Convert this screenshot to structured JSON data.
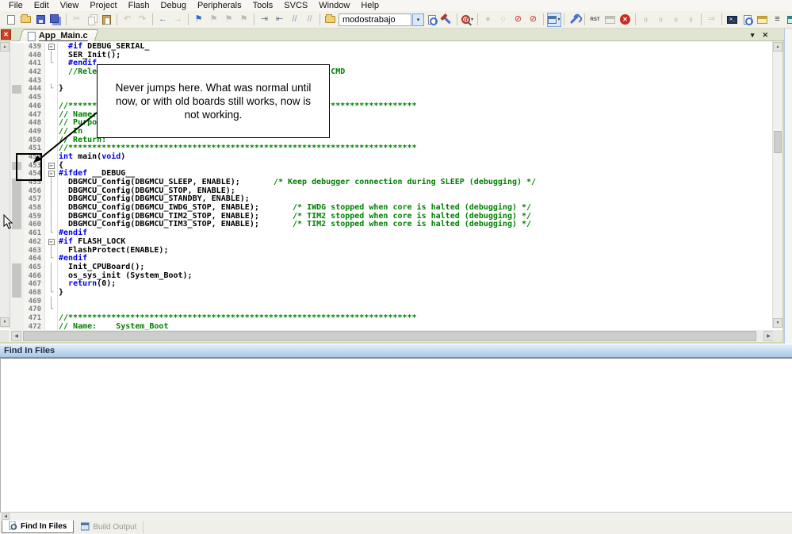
{
  "menu": {
    "items": [
      "File",
      "Edit",
      "View",
      "Project",
      "Flash",
      "Debug",
      "Peripherals",
      "Tools",
      "SVCS",
      "Window",
      "Help"
    ]
  },
  "toolbar": {
    "target_value": "modostrabajo",
    "items": [
      {
        "k": "icon",
        "n": "new-file-icon",
        "sh": "page"
      },
      {
        "k": "icon",
        "n": "open-file-icon",
        "sh": "folder"
      },
      {
        "k": "icon",
        "n": "save-icon",
        "sh": "floppy"
      },
      {
        "k": "icon",
        "n": "save-all-icon",
        "sh": "floppy2"
      },
      {
        "k": "sep"
      },
      {
        "k": "icon",
        "n": "cut-icon",
        "g": "✂",
        "col": "#9a9a93",
        "dis": true
      },
      {
        "k": "icon",
        "n": "copy-icon",
        "sh": "copy",
        "dis": true
      },
      {
        "k": "icon",
        "n": "paste-icon",
        "sh": "paste"
      },
      {
        "k": "sep"
      },
      {
        "k": "icon",
        "n": "undo-icon",
        "g": "↶",
        "col": "#9a9a93",
        "dis": true
      },
      {
        "k": "icon",
        "n": "redo-icon",
        "g": "↷",
        "col": "#9a9a93",
        "dis": true
      },
      {
        "k": "sep"
      },
      {
        "k": "icon",
        "n": "navigate-back-icon",
        "g": "←",
        "col": "#5b7aa8"
      },
      {
        "k": "icon",
        "n": "navigate-forward-icon",
        "g": "→",
        "col": "#8a98a8",
        "dis": true
      },
      {
        "k": "sep"
      },
      {
        "k": "icon",
        "n": "toggle-bookmark-icon",
        "g": "⚑",
        "col": "#2a6fd0"
      },
      {
        "k": "icon",
        "n": "prev-bookmark-icon",
        "g": "⚑",
        "col": "#8a8f98",
        "dis": true
      },
      {
        "k": "icon",
        "n": "next-bookmark-icon",
        "g": "⚑",
        "col": "#8a8f98",
        "dis": true
      },
      {
        "k": "icon",
        "n": "clear-bookmarks-icon",
        "g": "⚑",
        "col": "#8a8f98",
        "dis": true
      },
      {
        "k": "sep"
      },
      {
        "k": "icon",
        "n": "indent-icon",
        "g": "⇥",
        "col": "#6a7a8c"
      },
      {
        "k": "icon",
        "n": "outdent-icon",
        "g": "⇤",
        "col": "#6a7a8c"
      },
      {
        "k": "icon",
        "n": "comment-icon",
        "g": "//",
        "col": "#7aa0c0"
      },
      {
        "k": "icon",
        "n": "uncomment-icon",
        "g": "//",
        "col": "#a8acb4"
      },
      {
        "k": "sep"
      },
      {
        "k": "icon",
        "n": "flash-download-icon",
        "sh": "folder"
      },
      {
        "k": "combo",
        "n": "select-target-combo"
      },
      {
        "k": "combodd",
        "n": "select-target-dropdown-icon",
        "g": "▾"
      },
      {
        "k": "icon",
        "n": "find-in-files-icon",
        "sh": "docmag"
      },
      {
        "k": "icon",
        "n": "build-target-icon",
        "sh": "hammer"
      },
      {
        "k": "sep"
      },
      {
        "k": "icon",
        "n": "start-stop-debug-icon",
        "sh": "qmag",
        "g": "d",
        "dd": true
      },
      {
        "k": "sep"
      },
      {
        "k": "icon",
        "n": "toggle-breakpoint-icon",
        "g": "●",
        "col": "#a8a8a2",
        "dis": true
      },
      {
        "k": "icon",
        "n": "enable-breakpoint-icon",
        "g": "○",
        "col": "#a8a8a2",
        "dis": true
      },
      {
        "k": "icon",
        "n": "disable-all-breakpoints-icon",
        "g": "⊘",
        "col": "#cc3333"
      },
      {
        "k": "icon",
        "n": "kill-all-breakpoints-icon",
        "g": "⊘",
        "col": "#cc3333"
      },
      {
        "k": "sep"
      },
      {
        "k": "icon",
        "n": "debug-windows-icon",
        "sh": "win",
        "sel": true,
        "dd": true
      },
      {
        "k": "sep"
      },
      {
        "k": "icon",
        "n": "configure-tools-icon",
        "sh": "wrench"
      },
      {
        "k": "sep"
      },
      {
        "k": "icon",
        "n": "reset-cpu-icon",
        "g": "RST",
        "tiny": true,
        "col": "#444"
      },
      {
        "k": "icon",
        "n": "load-application-icon",
        "sh": "win gray",
        "dis": true
      },
      {
        "k": "icon",
        "n": "stop-debug-icon",
        "sh": "stopx",
        "g": "✕"
      },
      {
        "k": "sep"
      },
      {
        "k": "icon",
        "n": "step-icon",
        "g": "{}",
        "tiny": true,
        "col": "#8a8a84",
        "dis": true
      },
      {
        "k": "icon",
        "n": "step-over-icon",
        "g": "()",
        "tiny": true,
        "col": "#8a8a84",
        "dis": true
      },
      {
        "k": "icon",
        "n": "step-out-icon",
        "g": "{)",
        "tiny": true,
        "col": "#8a8a84",
        "dis": true
      },
      {
        "k": "icon",
        "n": "run-to-line-icon",
        "g": "()",
        "tiny": true,
        "col": "#8a8a84",
        "dis": true
      },
      {
        "k": "sep"
      },
      {
        "k": "icon",
        "n": "run-icon",
        "g": "⇒",
        "col": "#9a9a93",
        "dis": true
      },
      {
        "k": "sep"
      },
      {
        "k": "icon",
        "n": "command-window-icon",
        "sh": "cmdwin",
        "g": ">_"
      },
      {
        "k": "icon",
        "n": "disassembly-window-icon",
        "sh": "docmag"
      },
      {
        "k": "icon",
        "n": "symbol-window-icon",
        "sh": "win yellow"
      },
      {
        "k": "icon",
        "n": "registers-window-icon",
        "g": "≡",
        "col": "#333"
      },
      {
        "k": "icon",
        "n": "call-stack-window-icon",
        "sh": "win teal"
      },
      {
        "k": "icon",
        "n": "watch-window-icon",
        "sh": "win",
        "sel": true,
        "dd": true
      },
      {
        "k": "icon",
        "n": "memory-window-icon",
        "sh": "win gray",
        "dd": true
      },
      {
        "k": "icon",
        "n": "serial-window-icon",
        "sh": "win teal",
        "dd": true
      },
      {
        "k": "icon",
        "n": "analysis-window-icon",
        "sh": "win red",
        "dd": true
      },
      {
        "k": "icon",
        "n": "system-viewer-icon",
        "sh": "win",
        "dd": true
      }
    ]
  },
  "editor": {
    "tab_title": "App_Main.c",
    "lines": [
      {
        "n": 439,
        "f": "m",
        "s": [
          [
            "  ",
            "p"
          ],
          [
            "#if",
            "k"
          ],
          [
            " DEBUG_SERIAL_",
            "p"
          ]
        ]
      },
      {
        "n": 440,
        "f": "v",
        "s": [
          [
            "  SER_Init();",
            "p"
          ]
        ]
      },
      {
        "n": 441,
        "f": "e",
        "s": [
          [
            "  ",
            "p"
          ],
          [
            "#endif",
            "k"
          ]
        ]
      },
      {
        "n": 442,
        "f": "",
        "s": [
          [
            "  ",
            "p"
          ],
          [
            "//Reles",
            "c"
          ],
          [
            "                                                ",
            "p"
          ],
          [
            "CMD",
            "c"
          ]
        ]
      },
      {
        "n": 443,
        "f": "",
        "s": []
      },
      {
        "n": 444,
        "f": "e",
        "g": 1,
        "s": [
          [
            "}",
            "p"
          ]
        ]
      },
      {
        "n": 445,
        "f": "",
        "s": []
      },
      {
        "n": 446,
        "f": "",
        "s": [
          [
            "//*************************************************************************",
            "c"
          ]
        ]
      },
      {
        "n": 447,
        "f": "",
        "s": [
          [
            "// Name:",
            "c"
          ]
        ]
      },
      {
        "n": 448,
        "f": "",
        "s": [
          [
            "// Purpos",
            "c"
          ]
        ]
      },
      {
        "n": 449,
        "f": "",
        "s": [
          [
            "// In",
            "c"
          ]
        ]
      },
      {
        "n": 450,
        "f": "",
        "s": [
          [
            "// Return:",
            "c"
          ]
        ]
      },
      {
        "n": 451,
        "f": "",
        "s": [
          [
            "//*************************************************************************",
            "c"
          ]
        ]
      },
      {
        "n": 452,
        "f": "",
        "s": [
          [
            "int",
            "k"
          ],
          [
            " main(",
            "p"
          ],
          [
            "void",
            "k"
          ],
          [
            ")",
            "p"
          ]
        ]
      },
      {
        "n": 453,
        "f": "m",
        "g": 1,
        "s": [
          [
            "{",
            "p"
          ]
        ]
      },
      {
        "n": 454,
        "f": "m",
        "s": [
          [
            "#ifdef",
            "k"
          ],
          [
            " __DEBUG__",
            "p"
          ]
        ]
      },
      {
        "n": 455,
        "f": "v",
        "g": 1,
        "s": [
          [
            "  DBGMCU_Config(DBGMCU_SLEEP, ENABLE);       ",
            "p"
          ],
          [
            "/* Keep debugger connection during SLEEP (debugging) */",
            "c"
          ]
        ]
      },
      {
        "n": 456,
        "f": "v",
        "g": 1,
        "s": [
          [
            "  DBGMCU_Config(DBGMCU_STOP, ENABLE);",
            "p"
          ]
        ]
      },
      {
        "n": 457,
        "f": "v",
        "g": 1,
        "s": [
          [
            "  DBGMCU_Config(DBGMCU_STANDBY, ENABLE);",
            "p"
          ]
        ]
      },
      {
        "n": 458,
        "f": "v",
        "g": 1,
        "s": [
          [
            "  DBGMCU_Config(DBGMCU_IWDG_STOP, ENABLE);       ",
            "p"
          ],
          [
            "/* IWDG stopped when core is halted (debugging) */",
            "c"
          ]
        ]
      },
      {
        "n": 459,
        "f": "v",
        "g": 1,
        "s": [
          [
            "  DBGMCU_Config(DBGMCU_TIM2_STOP, ENABLE);       ",
            "p"
          ],
          [
            "/* TIM2 stopped when core is halted (debugging) */",
            "c"
          ]
        ]
      },
      {
        "n": 460,
        "f": "v",
        "g": 1,
        "s": [
          [
            "  DBGMCU_Config(DBGMCU_TIM3_STOP, ENABLE);       ",
            "p"
          ],
          [
            "/* TIM2 stopped when core is halted (debugging) */",
            "c"
          ]
        ]
      },
      {
        "n": 461,
        "f": "e",
        "s": [
          [
            "#endif",
            "k"
          ]
        ]
      },
      {
        "n": 462,
        "f": "m",
        "s": [
          [
            "#if",
            "k"
          ],
          [
            " FLASH_LOCK",
            "p"
          ]
        ]
      },
      {
        "n": 463,
        "f": "v",
        "s": [
          [
            "  FlashProtect(ENABLE);",
            "p"
          ]
        ]
      },
      {
        "n": 464,
        "f": "e",
        "s": [
          [
            "#endif",
            "k"
          ]
        ]
      },
      {
        "n": 465,
        "f": "v",
        "g": 1,
        "s": [
          [
            "  Init_CPUBoard();",
            "p"
          ]
        ]
      },
      {
        "n": 466,
        "f": "v",
        "g": 1,
        "s": [
          [
            "  os_sys_init (System_Boot);",
            "p"
          ]
        ]
      },
      {
        "n": 467,
        "f": "v",
        "g": 1,
        "s": [
          [
            "  ",
            "p"
          ],
          [
            "return",
            "k"
          ],
          [
            "(0);",
            "p"
          ]
        ]
      },
      {
        "n": 468,
        "f": "e",
        "g": 1,
        "s": [
          [
            "}",
            "p"
          ]
        ]
      },
      {
        "n": 469,
        "f": "v",
        "s": []
      },
      {
        "n": 470,
        "f": "e",
        "s": []
      },
      {
        "n": 471,
        "f": "",
        "s": [
          [
            "//*************************************************************************",
            "c"
          ]
        ]
      },
      {
        "n": 472,
        "f": "",
        "s": [
          [
            "// Name:    System_Boot",
            "c"
          ]
        ]
      }
    ]
  },
  "annotation": {
    "text": "Never jumps here. What was normal until now, or with old boards still works, now is not working."
  },
  "panels": {
    "find_in_files_title": "Find In Files"
  },
  "bottom_tabs": [
    {
      "label": "Find In Files",
      "active": true
    },
    {
      "label": "Build Output",
      "active": false
    }
  ],
  "colors": {
    "keyword": "#0000ee",
    "comment": "#008000",
    "plain": "#000000",
    "line_number": "#7c7c7c",
    "tabbar_bg": "#e0e5d2",
    "header_blue": "#a9c8e6",
    "stop_red": "#c92a22",
    "change_bar": "#c5c5c3"
  }
}
